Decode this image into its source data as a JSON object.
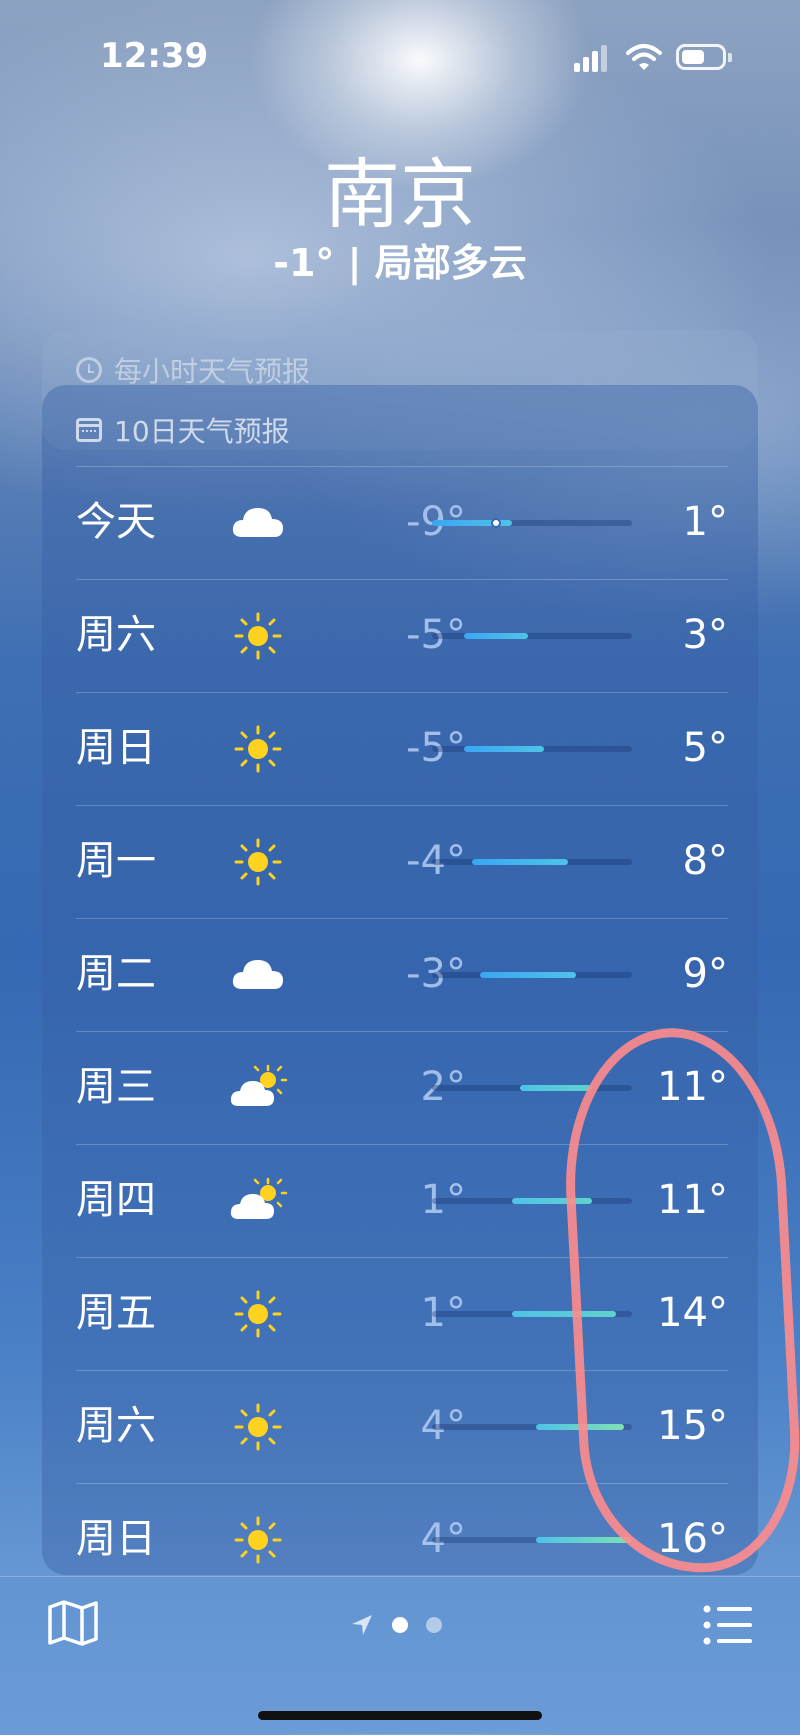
{
  "status_bar": {
    "time": "12:39"
  },
  "location": {
    "city": "南京",
    "summary": "-1° | 局部多云"
  },
  "hourly": {
    "title": "每小时天气预报"
  },
  "daily": {
    "title": "10日天气预报",
    "scale": {
      "min": -9,
      "max": 16
    },
    "rows": [
      {
        "day": "今天",
        "icon": "cloud-icon",
        "low": "-9°",
        "high": "1°",
        "low_value": -9,
        "high_value": 1,
        "current_value": -1
      },
      {
        "day": "周六",
        "icon": "sun-icon",
        "low": "-5°",
        "high": "3°",
        "low_value": -5,
        "high_value": 3
      },
      {
        "day": "周日",
        "icon": "sun-icon",
        "low": "-5°",
        "high": "5°",
        "low_value": -5,
        "high_value": 5
      },
      {
        "day": "周一",
        "icon": "sun-icon",
        "low": "-4°",
        "high": "8°",
        "low_value": -4,
        "high_value": 8
      },
      {
        "day": "周二",
        "icon": "cloud-icon",
        "low": "-3°",
        "high": "9°",
        "low_value": -3,
        "high_value": 9
      },
      {
        "day": "周三",
        "icon": "partly-cloudy-icon",
        "low": "2°",
        "high": "11°",
        "low_value": 2,
        "high_value": 11
      },
      {
        "day": "周四",
        "icon": "partly-cloudy-icon",
        "low": "1°",
        "high": "11°",
        "low_value": 1,
        "high_value": 11
      },
      {
        "day": "周五",
        "icon": "sun-icon",
        "low": "1°",
        "high": "14°",
        "low_value": 1,
        "high_value": 14
      },
      {
        "day": "周六",
        "icon": "sun-icon",
        "low": "4°",
        "high": "15°",
        "low_value": 4,
        "high_value": 15
      },
      {
        "day": "周日",
        "icon": "sun-icon",
        "low": "4°",
        "high": "16°",
        "low_value": 4,
        "high_value": 16
      }
    ]
  },
  "colors": {
    "bar_cold": "#3aa6f2",
    "bar_cool": "#4fc3e8",
    "bar_mild": "#5fd2cc",
    "bar_warm": "#7fe0b4",
    "sun": "#ffd21f",
    "annotation": "#ff8c8c"
  },
  "toolbar": {
    "map_icon": "map-icon",
    "location_icon": "location-arrow-icon",
    "list_icon": "list-icon"
  }
}
